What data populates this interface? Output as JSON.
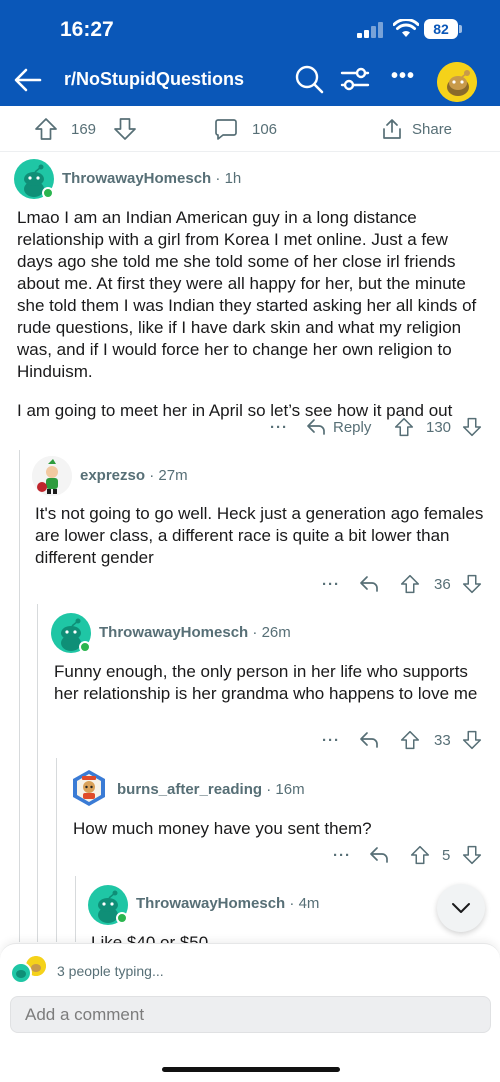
{
  "status_bar": {
    "time": "16:27",
    "battery": "82"
  },
  "nav": {
    "title": "r/NoStupidQuestions",
    "more": "•••"
  },
  "post_actions": {
    "upvotes": "169",
    "comments": "106",
    "share": "Share"
  },
  "comments": [
    {
      "username": "ThrowawayHomesch",
      "age": "1h",
      "paragraphs": [
        "Lmao I am an Indian American guy in a long distance relationship with a girl from Korea I met online. Just a few days ago she told me she told some of her close irl friends about me. At first they were all happy for her, but the minute she told them I was Indian they started asking her all kinds of rude questions, like if I have dark skin and what my religion was, and if I would force her to change her own religion to Hinduism.",
        "I am going to meet her in April so let’s see how it pand out"
      ],
      "reply_label": "Reply",
      "votes": "130"
    },
    {
      "username": "exprezso",
      "age": "27m",
      "paragraphs": [
        "It's not going to go well. Heck just a generation ago females are lower class, a different race is quite a bit lower than different gender"
      ],
      "votes": "36"
    },
    {
      "username": "ThrowawayHomesch",
      "age": "26m",
      "paragraphs": [
        "Funny enough, the only person in her life who supports her relationship is her grandma who happens to love me"
      ],
      "votes": "33"
    },
    {
      "username": "burns_after_reading",
      "age": "16m",
      "paragraphs": [
        "How much money have you sent them?"
      ],
      "votes": "5"
    },
    {
      "username": "ThrowawayHomesch",
      "age": "4m",
      "paragraphs": [
        "Like $40 or $50"
      ]
    }
  ],
  "bottom": {
    "typing": "3 people typing...",
    "input_placeholder": "Add a comment"
  },
  "colors": {
    "header": "#0a57b8",
    "online": "#2bb54f",
    "avatar_teal": "#1fc6a5"
  }
}
